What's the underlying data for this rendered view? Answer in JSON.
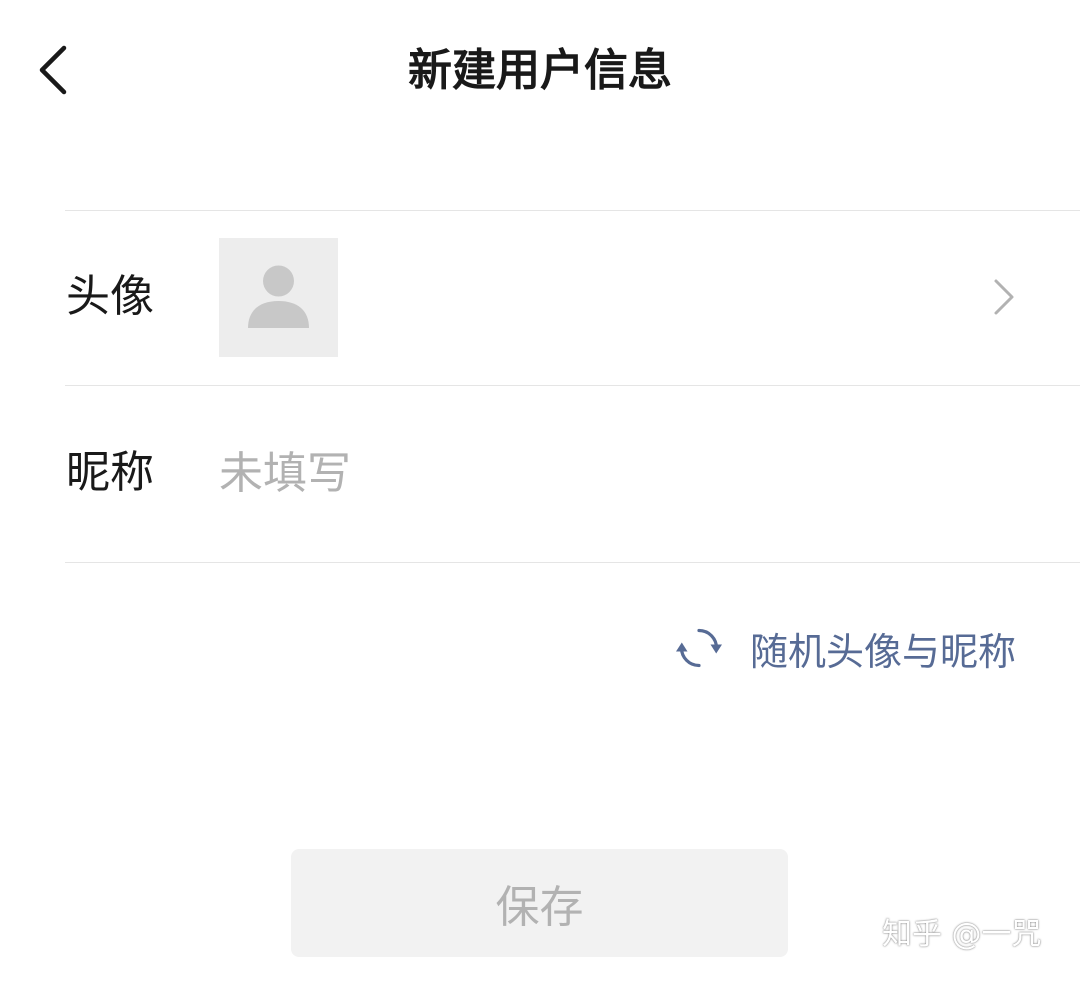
{
  "header": {
    "title": "新建用户信息",
    "back_icon": "chevron-left-icon"
  },
  "avatar_row": {
    "label": "头像",
    "placeholder_icon": "user-silhouette-icon",
    "chevron_icon": "chevron-right-icon"
  },
  "nickname_row": {
    "label": "昵称",
    "value": "",
    "placeholder": "未填写"
  },
  "random_link": {
    "icon": "refresh-icon",
    "label": "随机头像与昵称"
  },
  "save_button": {
    "label": "保存",
    "enabled": false
  },
  "watermark": "知乎 @一咒",
  "colors": {
    "link": "#576b95",
    "placeholder": "#b2b2b2",
    "divider": "#e5e5e5",
    "button_bg": "#f2f2f2",
    "avatar_bg": "#ededed"
  }
}
